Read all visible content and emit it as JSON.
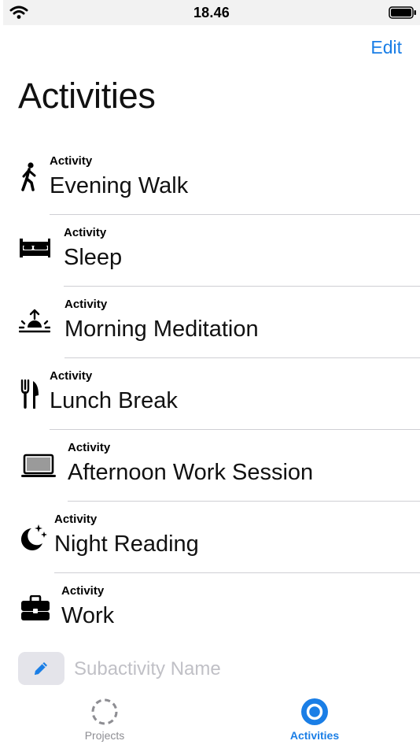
{
  "status_bar": {
    "time": "18.46",
    "icons": [
      "wifi-icon",
      "battery-icon"
    ]
  },
  "nav": {
    "edit_label": "Edit"
  },
  "page": {
    "title": "Activities"
  },
  "activities": [
    {
      "kicker": "Activity",
      "name": "Evening Walk",
      "icon": "walking-icon"
    },
    {
      "kicker": "Activity",
      "name": "Sleep",
      "icon": "bed-icon"
    },
    {
      "kicker": "Activity",
      "name": "Morning Meditation",
      "icon": "sunrise-icon"
    },
    {
      "kicker": "Activity",
      "name": "Lunch Break",
      "icon": "fork-knife-icon"
    },
    {
      "kicker": "Activity",
      "name": "Afternoon Work Session",
      "icon": "laptop-icon"
    },
    {
      "kicker": "Activity",
      "name": "Night Reading",
      "icon": "moon-stars-icon"
    },
    {
      "kicker": "Activity",
      "name": "Work",
      "icon": "briefcase-icon"
    }
  ],
  "new_subactivity": {
    "placeholder": "Subactivity Name",
    "icon": "pencil-icon"
  },
  "tab_bar": {
    "tabs": [
      {
        "label": "Projects",
        "icon": "dashed-circle-icon",
        "selected": false
      },
      {
        "label": "Activities",
        "icon": "filled-circle-icon",
        "selected": true
      }
    ]
  },
  "colors": {
    "accent": "#1a7ee6",
    "separator": "#cfcfd4",
    "placeholder": "#c0c0c6",
    "inactive_tab": "#8e8e93"
  }
}
